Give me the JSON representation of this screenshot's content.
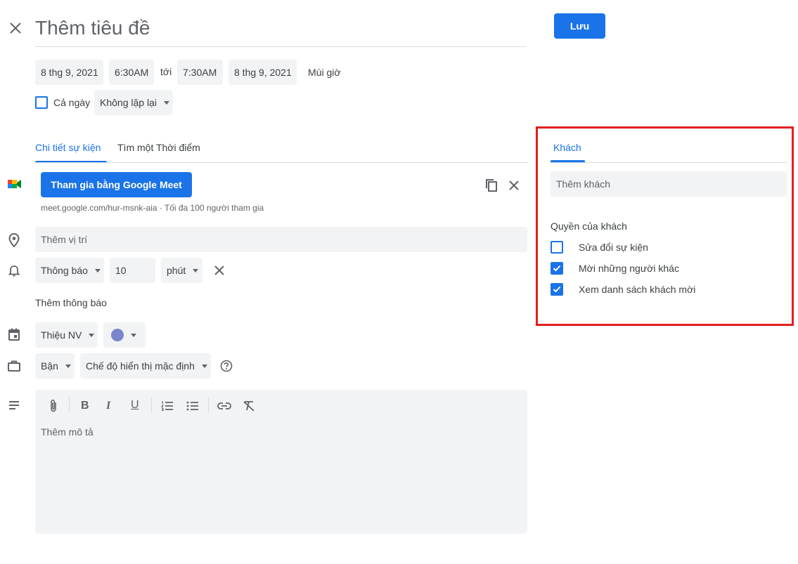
{
  "header": {
    "title_placeholder": "Thêm tiêu đề",
    "save_label": "Lưu"
  },
  "datetime": {
    "start_date": "8 thg 9, 2021",
    "start_time": "6:30AM",
    "to_label": "tới",
    "end_time": "7:30AM",
    "end_date": "8 thg 9, 2021",
    "timezone_label": "Múi giờ",
    "all_day_label": "Cả ngày",
    "all_day_checked": false,
    "repeat_value": "Không lặp lại"
  },
  "tabs": {
    "details": "Chi tiết sự kiện",
    "find_time": "Tìm một Thời điểm",
    "active": "details"
  },
  "meet": {
    "button_label": "Tham gia bằng Google Meet",
    "info": "meet.google.com/hur-msnk-aia · Tối đa 100 người tham gia"
  },
  "location": {
    "placeholder": "Thêm vị trí"
  },
  "notification": {
    "type": "Thông báo",
    "amount": "10",
    "unit": "phút",
    "add_label": "Thêm thông báo"
  },
  "calendar": {
    "name": "Thiệu NV",
    "color": "#7986cb"
  },
  "availability": {
    "status": "Bận",
    "visibility": "Chế độ hiển thị mặc định"
  },
  "description": {
    "placeholder": "Thêm mô tả"
  },
  "guests": {
    "tab_label": "Khách",
    "add_placeholder": "Thêm khách",
    "permissions_title": "Quyền của khách",
    "permissions": [
      {
        "label": "Sửa đổi sự kiện",
        "checked": false
      },
      {
        "label": "Mời những người khác",
        "checked": true
      },
      {
        "label": "Xem danh sách khách mời",
        "checked": true
      }
    ]
  },
  "colors": {
    "accent": "#1a73e8",
    "highlight_border": "#e02020"
  },
  "icons": {
    "close": "close-icon",
    "meet": "google-meet-icon",
    "copy": "copy-icon",
    "remove_meet": "close-icon",
    "location": "location-pin-icon",
    "bell": "bell-icon",
    "calendar": "calendar-icon",
    "briefcase": "briefcase-icon",
    "help": "help-circle-icon",
    "description": "notes-icon"
  }
}
